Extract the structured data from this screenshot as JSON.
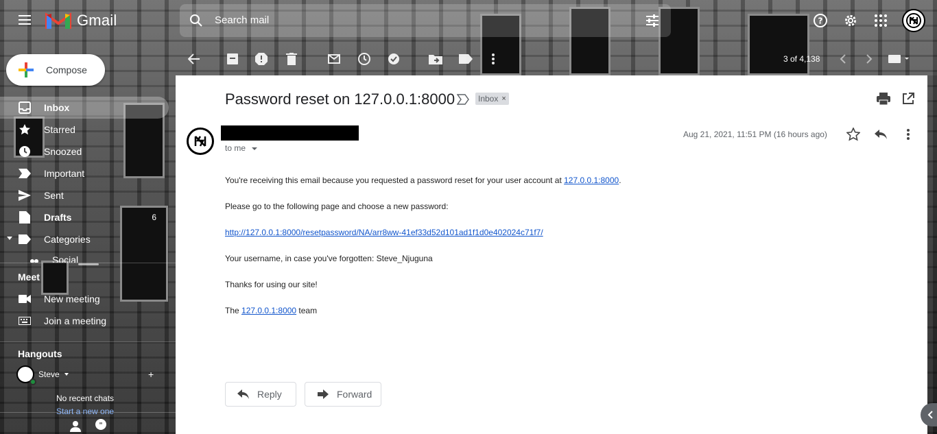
{
  "app": {
    "name": "Gmail"
  },
  "search": {
    "placeholder": "Search mail"
  },
  "compose": {
    "label": "Compose"
  },
  "sidebar": {
    "items": [
      {
        "label": "Inbox",
        "count": "",
        "icon": "inbox-icon"
      },
      {
        "label": "Starred",
        "count": "",
        "icon": "star-icon"
      },
      {
        "label": "Snoozed",
        "count": "",
        "icon": "clock-icon"
      },
      {
        "label": "Important",
        "count": "",
        "icon": "label-important-icon"
      },
      {
        "label": "Sent",
        "count": "",
        "icon": "send-icon"
      },
      {
        "label": "Drafts",
        "count": "6",
        "icon": "draft-icon"
      },
      {
        "label": "Categories",
        "count": "",
        "icon": "label-icon"
      },
      {
        "label": "Social",
        "count": "",
        "icon": "people-icon"
      }
    ],
    "meet": {
      "title": "Meet",
      "new_meeting": "New meeting",
      "join_meeting": "Join a meeting"
    },
    "hangouts": {
      "title": "Hangouts",
      "user": "Steve",
      "no_chats": "No recent chats",
      "start_new": "Start a new one"
    }
  },
  "toolbar": {
    "pager": "3 of 4,138"
  },
  "message": {
    "subject": "Password reset on 127.0.0.1:8000",
    "label": "Inbox",
    "to": "to me",
    "date": "Aug 21, 2021, 11:51 PM (16 hours ago)",
    "line1_pre": "You're receiving this email because you requested a password reset for your user account at ",
    "line1_link": "127.0.0.1:8000",
    "line1_post": ".",
    "line2": "Please go to the following page and choose a new password:",
    "reset_link": "http://127.0.0.1:8000/resetpassword/NA/arr8ww-41ef33d52d101ad1f1d0e402024c71f7/",
    "line3": "Your username, in case you've forgotten: Steve_Njuguna",
    "line4": "Thanks for using our site!",
    "line5_pre": "The ",
    "line5_link": "127.0.0.1:8000",
    "line5_post": " team"
  },
  "actions": {
    "reply": "Reply",
    "forward": "Forward"
  },
  "colors": {
    "link": "#1155cc",
    "compose_red": "#ea4335",
    "compose_blue": "#4285f4",
    "compose_green": "#34a853",
    "compose_yellow": "#fbbc04",
    "online": "#1e8e3e"
  }
}
